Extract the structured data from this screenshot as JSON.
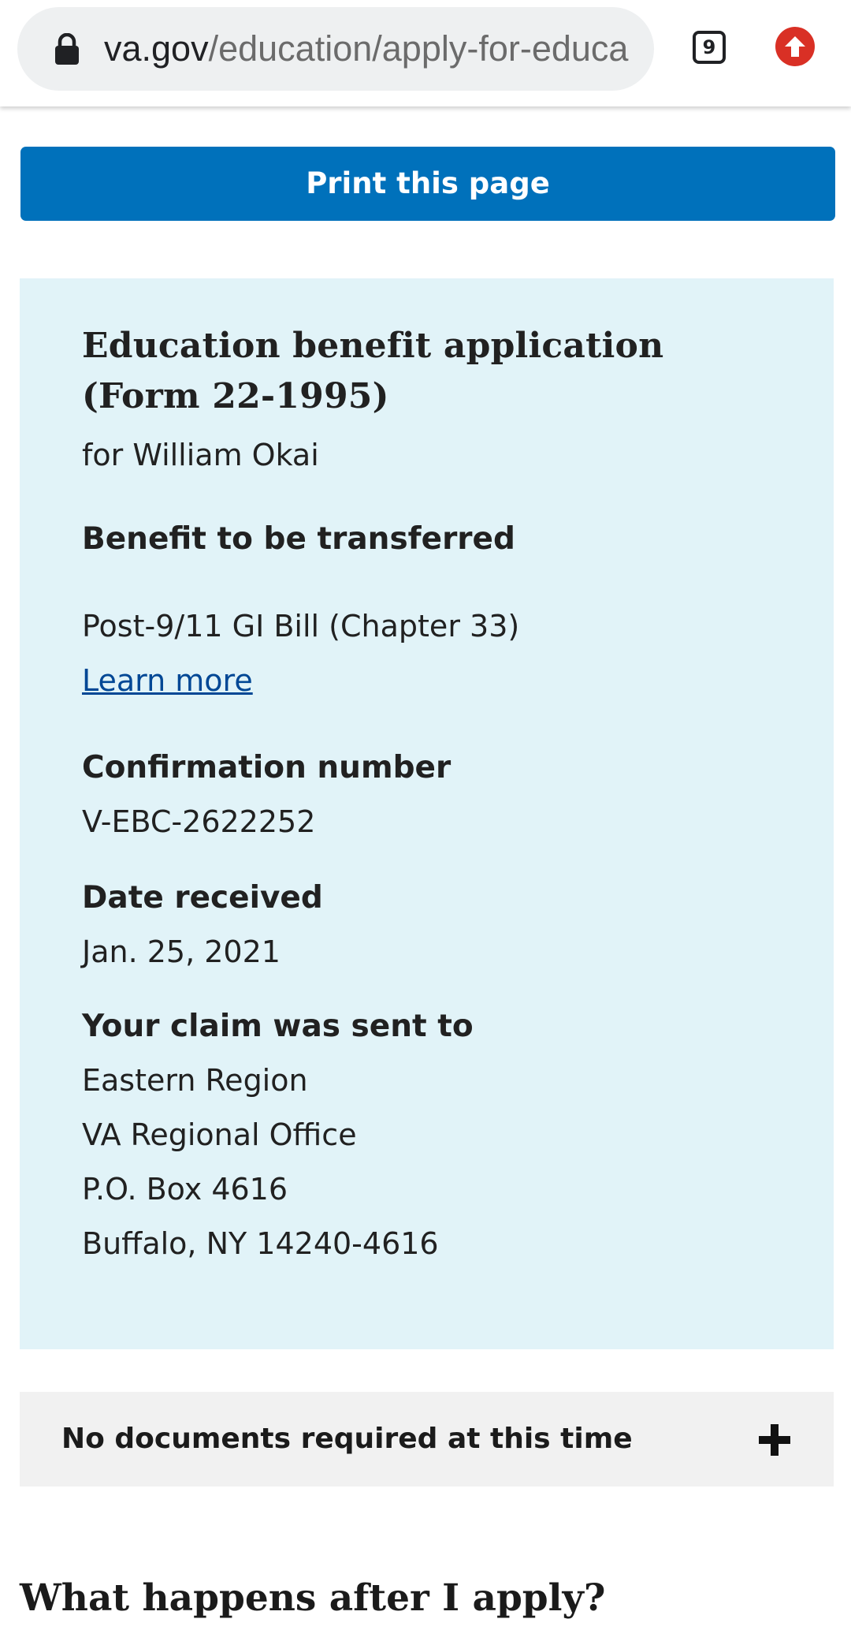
{
  "browser": {
    "url_domain": "va.gov",
    "url_path": "/education/apply-for-educa",
    "tab_count": "9",
    "upload_icon": "arrow-up-circle-icon",
    "lock_icon": "lock-icon"
  },
  "print_button": {
    "label": "Print this page",
    "color": "#0071bb"
  },
  "summary": {
    "background": "#e1f3f8",
    "title_line1": "Education benefit application",
    "title_line2": "(Form 22-1995)",
    "applicant": "for William Okai",
    "benefit_label": "Benefit to be transferred",
    "benefit_value": "Post-9/11 GI Bill (Chapter 33)",
    "learn_more": "Learn more",
    "confirmation_label": "Confirmation number",
    "confirmation_value": "V-EBC-2622252",
    "date_label": "Date received",
    "date_value": "Jan. 25, 2021",
    "sent_to_label": "Your claim was sent to",
    "address": [
      "Eastern Region",
      "VA Regional Office",
      "P.O. Box 4616",
      "Buffalo, NY 14240-4616"
    ]
  },
  "accordion": {
    "label": "No documents required at this time",
    "icon": "plus-icon"
  },
  "next_section": {
    "heading": "What happens after I apply?"
  }
}
